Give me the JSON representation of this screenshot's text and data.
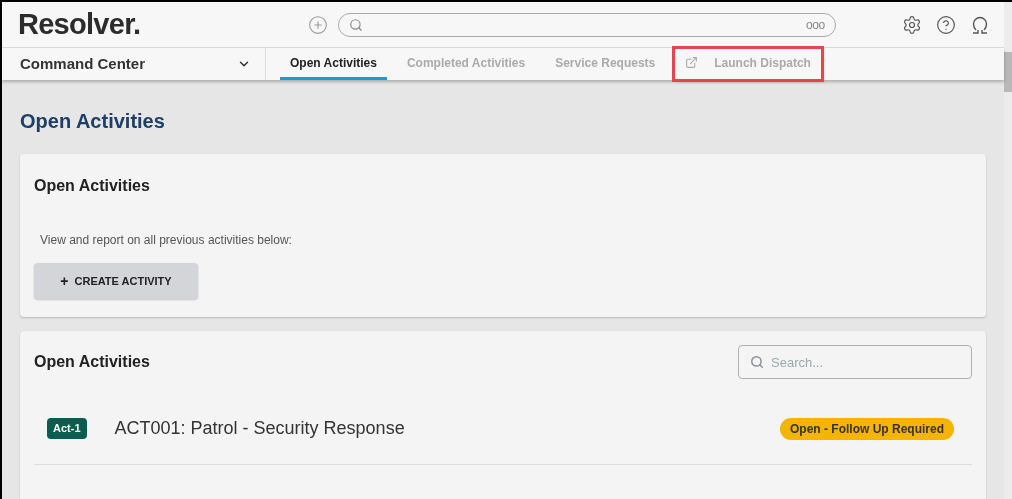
{
  "header": {
    "logo": "Resolver.",
    "search": {
      "more": "ooo"
    }
  },
  "nav": {
    "workspace": "Command Center",
    "tabs": [
      {
        "label": "Open Activities",
        "selected": true,
        "kind": "tab",
        "highlighted": false
      },
      {
        "label": "Completed Activities",
        "selected": false,
        "kind": "tab",
        "highlighted": false
      },
      {
        "label": "Service Requests",
        "selected": false,
        "kind": "tab",
        "highlighted": false
      },
      {
        "label": "Launch Dispatch",
        "selected": false,
        "kind": "external",
        "highlighted": true
      }
    ]
  },
  "page_title": "Open Activities",
  "intro_card": {
    "title": "Open Activities",
    "description": "View and report on all previous activities below:",
    "button": "CREATE ACTIVITY",
    "button_icon": "+"
  },
  "list_card": {
    "title": "Open Activities",
    "search": {
      "placeholder": "Search..."
    },
    "rows": [
      {
        "tag": "Act-1",
        "title": "ACT001: Patrol - Security Response",
        "status": "Open - Follow Up Required",
        "color": "#f5b400"
      }
    ]
  }
}
